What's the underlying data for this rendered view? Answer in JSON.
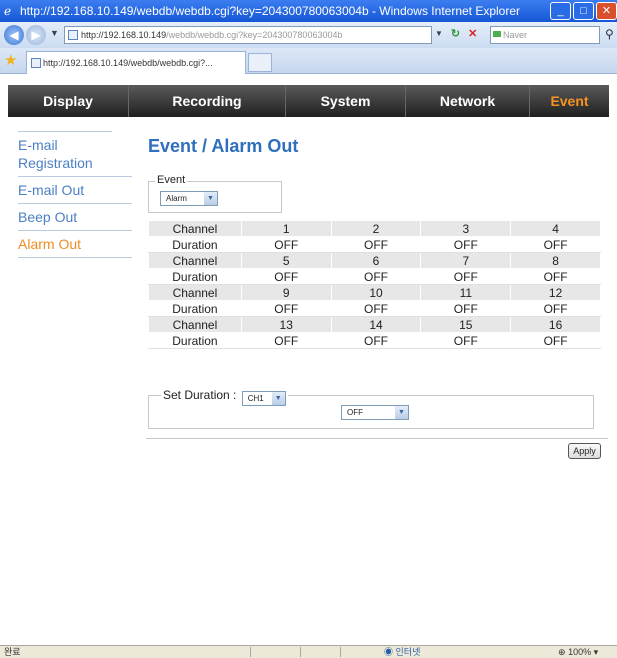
{
  "window": {
    "title": "http://192.168.10.149/webdb/webdb.cgi?key=204300780063004b - Windows Internet Explorer",
    "address_host": "http://192.168.10.149",
    "address_path": "/webdb/webdb.cgi?key=204300780063004b",
    "search_placeholder": "Naver",
    "tab_label": "http://192.168.10.149/webdb/webdb.cgi?...",
    "status_text": "완료",
    "status_zone": "인터넷",
    "status_zoom": "100%"
  },
  "menu": [
    {
      "label": "Display"
    },
    {
      "label": "Recording"
    },
    {
      "label": "System"
    },
    {
      "label": "Network"
    },
    {
      "label": "Event"
    }
  ],
  "sidebar": [
    {
      "label": "E-mail Registration"
    },
    {
      "label": "E-mail Out"
    },
    {
      "label": "Beep Out"
    },
    {
      "label": "Alarm Out"
    }
  ],
  "page": {
    "title": "Event / Alarm Out",
    "event_label": "Event",
    "event_value": "Alarm",
    "set_duration_label": "Set Duration :",
    "set_duration_channel": "CH1",
    "set_duration_value": "OFF",
    "apply_label": "Apply"
  },
  "table": {
    "rows": [
      [
        "Channel",
        "1",
        "2",
        "3",
        "4"
      ],
      [
        "Duration",
        "OFF",
        "OFF",
        "OFF",
        "OFF"
      ],
      [
        "Channel",
        "5",
        "6",
        "7",
        "8"
      ],
      [
        "Duration",
        "OFF",
        "OFF",
        "OFF",
        "OFF"
      ],
      [
        "Channel",
        "9",
        "10",
        "11",
        "12"
      ],
      [
        "Duration",
        "OFF",
        "OFF",
        "OFF",
        "OFF"
      ],
      [
        "Channel",
        "13",
        "14",
        "15",
        "16"
      ],
      [
        "Duration",
        "OFF",
        "OFF",
        "OFF",
        "OFF"
      ]
    ]
  },
  "colors": {
    "accent_orange": "#f7941d",
    "link_blue": "#4a7fc4",
    "title_blue": "#2f6fbd"
  }
}
